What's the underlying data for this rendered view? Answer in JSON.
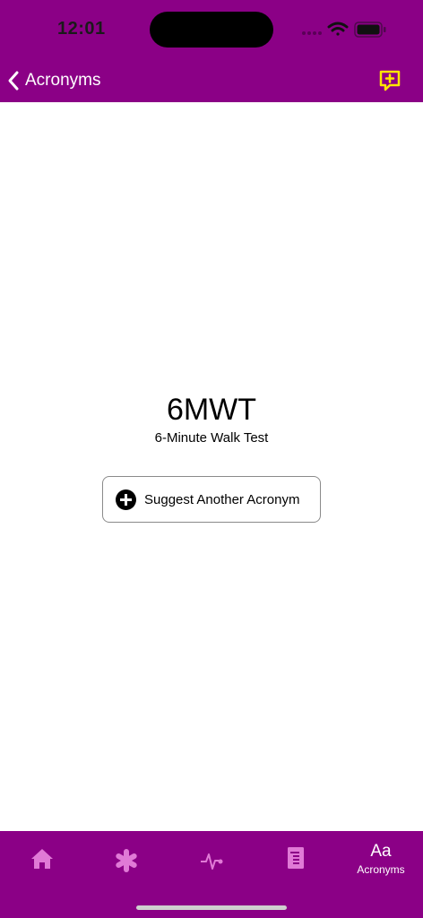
{
  "status_bar": {
    "time": "12:01",
    "icons": [
      "cellular-icon",
      "wifi-icon",
      "battery-icon"
    ]
  },
  "nav_bar": {
    "back_label": "Acronyms",
    "right_icon": "suggest-icon"
  },
  "acronym": {
    "code": "6MWT",
    "definition": "6-Minute Walk Test"
  },
  "suggest_button": {
    "label": "Suggest Another Acronym",
    "icon": "plus-circle-icon"
  },
  "tab_bar": {
    "tabs": [
      {
        "icon": "home-icon",
        "selected": false
      },
      {
        "icon": "asterisk-icon",
        "selected": false
      },
      {
        "icon": "pulse-icon",
        "selected": false
      },
      {
        "icon": "document-icon",
        "selected": false
      },
      {
        "icon": "acronyms-icon",
        "glyph": "Aa",
        "label": "Acronyms",
        "selected": true
      }
    ]
  },
  "colors": {
    "brand": "#8b0086",
    "accent_icon": "#ffe600",
    "tab_inactive": "#e07ad6",
    "tab_active": "#ffffff"
  }
}
